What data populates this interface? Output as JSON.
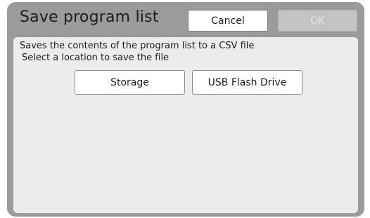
{
  "dialog": {
    "title": "Save program list",
    "cancel_label": "Cancel",
    "ok_label": "OK",
    "message_line1": "Saves the contents of the program list to a CSV file",
    "message_line2": "Select a location to save the file",
    "options": [
      {
        "label": "Storage"
      },
      {
        "label": "USB Flash Drive"
      }
    ]
  },
  "colors": {
    "frame": "#9b9b9b",
    "panel": "#ececec",
    "button": "#ffffff",
    "disabled_button": "#c3c3c3"
  }
}
